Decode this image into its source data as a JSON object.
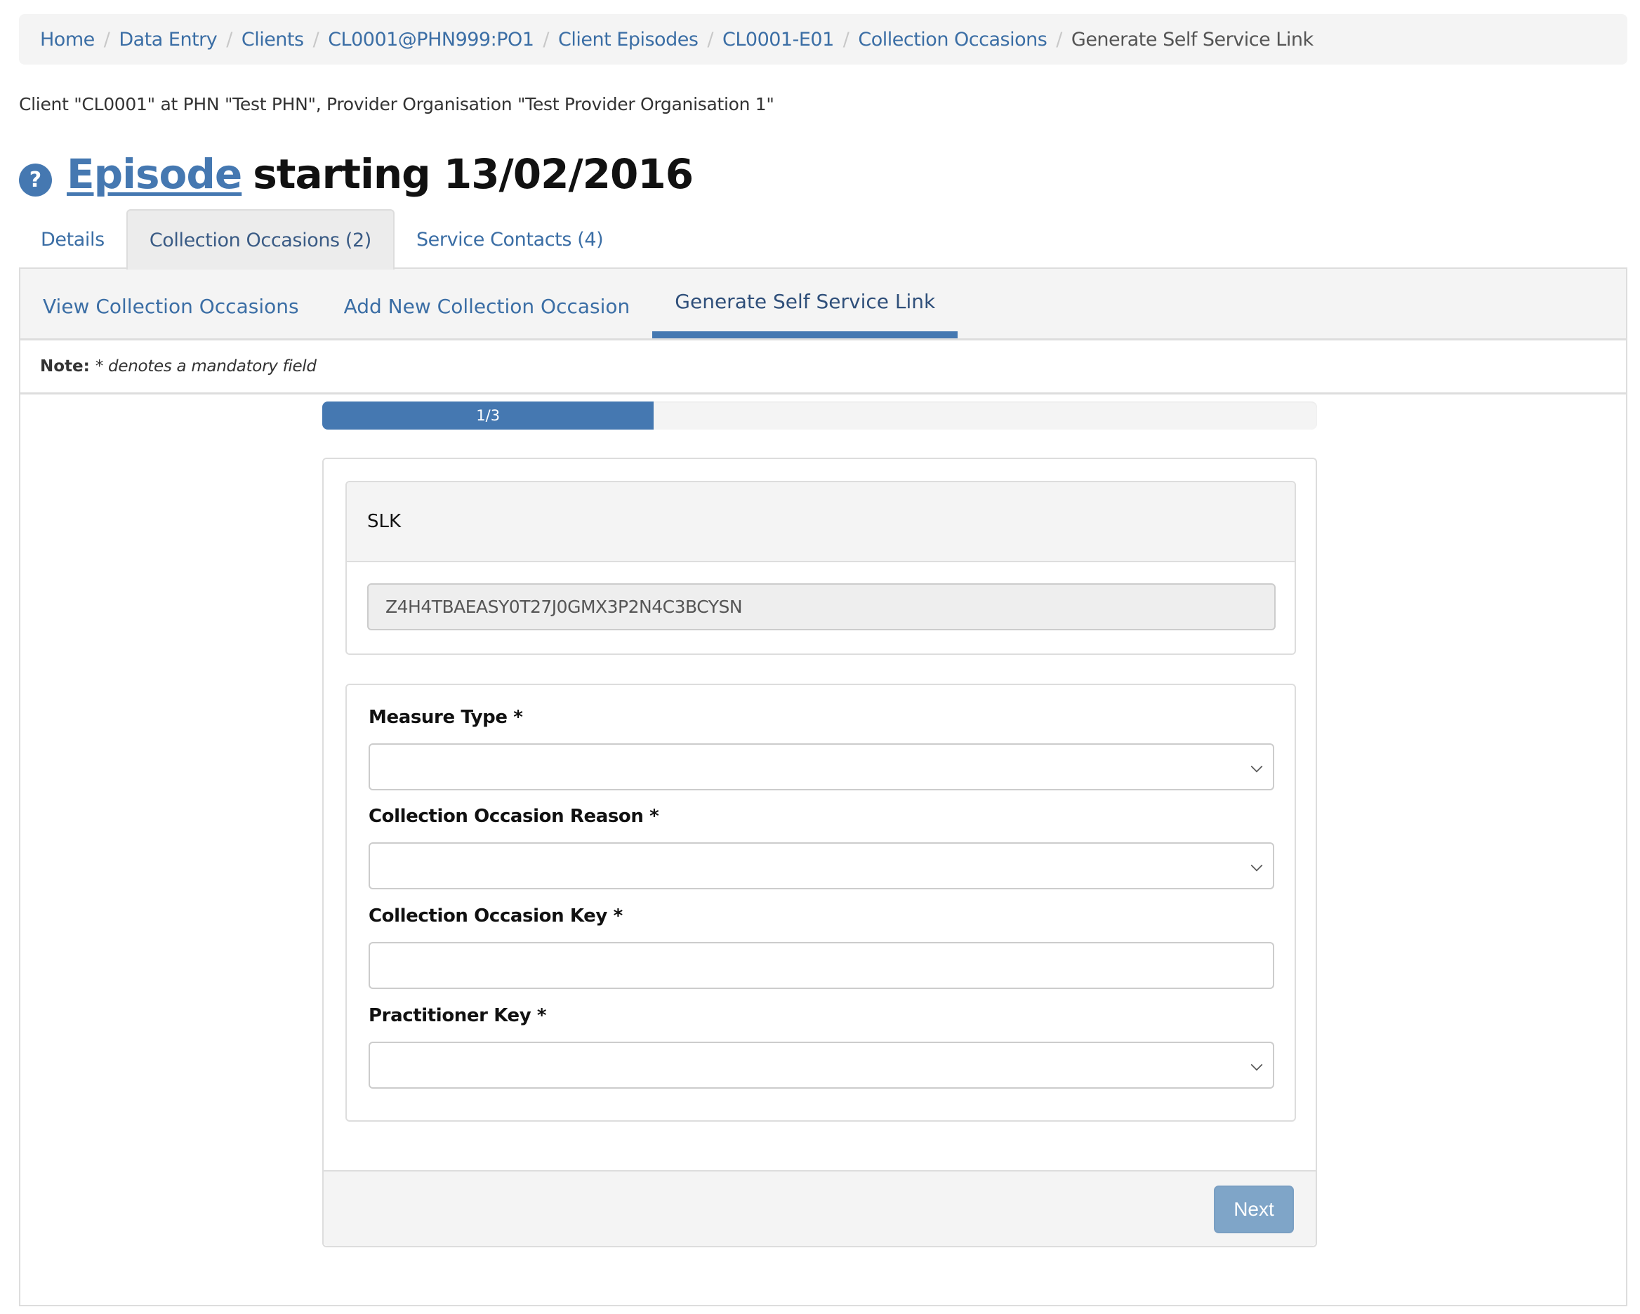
{
  "breadcrumb": [
    {
      "label": "Home",
      "current": false
    },
    {
      "label": "Data Entry",
      "current": false
    },
    {
      "label": "Clients",
      "current": false
    },
    {
      "label": "CL0001@PHN999:PO1",
      "current": false
    },
    {
      "label": "Client Episodes",
      "current": false
    },
    {
      "label": "CL0001-E01",
      "current": false
    },
    {
      "label": "Collection Occasions",
      "current": false
    },
    {
      "label": "Generate Self Service Link",
      "current": true
    }
  ],
  "breadcrumb_separator": "/",
  "client_info": "Client \"CL0001\" at PHN \"Test PHN\", Provider Organisation \"Test Provider Organisation 1\"",
  "title": {
    "help_icon": "?",
    "link": "Episode",
    "rest": "starting 13/02/2016"
  },
  "tabs": [
    {
      "label": "Details",
      "active": false
    },
    {
      "label": "Collection Occasions (2)",
      "active": true
    },
    {
      "label": "Service Contacts (4)",
      "active": false
    }
  ],
  "subnav": [
    {
      "label": "View Collection Occasions",
      "active": false
    },
    {
      "label": "Add New Collection Occasion",
      "active": false
    },
    {
      "label": "Generate Self Service Link",
      "active": true
    }
  ],
  "note": {
    "label": "Note:",
    "text": "* denotes a mandatory field"
  },
  "progress": {
    "label": "1/3",
    "step": 1,
    "total": 3
  },
  "slk": {
    "header": "SLK",
    "value": "Z4H4TBAEASY0T27J0GMX3P2N4C3BCYSN"
  },
  "fields": [
    {
      "label": "Measure Type *",
      "type": "select",
      "value": ""
    },
    {
      "label": "Collection Occasion Reason *",
      "type": "select",
      "value": ""
    },
    {
      "label": "Collection Occasion Key *",
      "type": "text",
      "value": ""
    },
    {
      "label": "Practitioner Key *",
      "type": "select",
      "value": ""
    }
  ],
  "footer": {
    "next_label": "Next"
  },
  "colors": {
    "accent": "#4578b1",
    "link": "#3b6ea5",
    "button_disabled": "#7fa5c8"
  }
}
